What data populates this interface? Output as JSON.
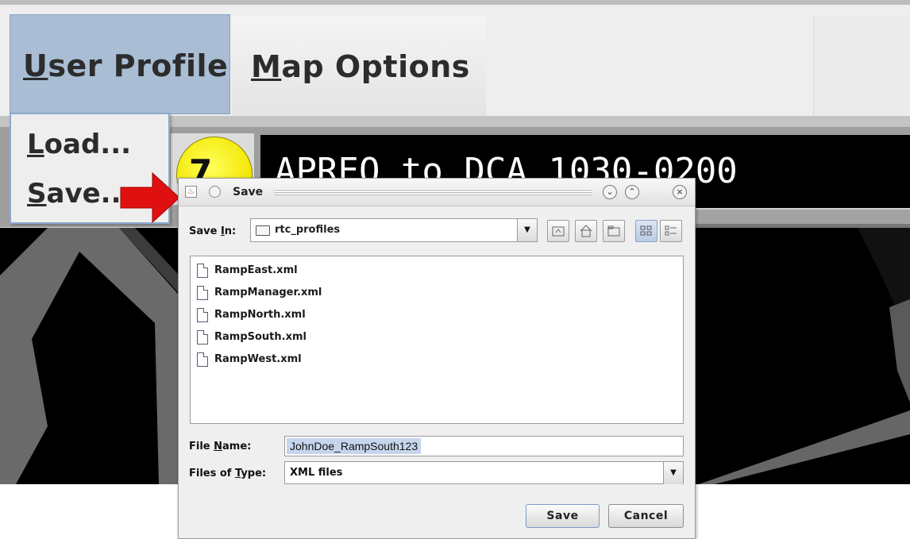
{
  "app": {
    "menus": [
      {
        "label_first": "U",
        "label_rest": "ser Profile"
      },
      {
        "label_first": "M",
        "label_rest": "ap Options"
      }
    ],
    "dropdown": {
      "load": {
        "first": "L",
        "rest": "oad..."
      },
      "save": {
        "first": "S",
        "rest": "ave..."
      }
    },
    "badge_number": "7",
    "title": "APREQ to DCA 1030-0200"
  },
  "dialog": {
    "title": "Save",
    "save_in_label": {
      "pre": "Save ",
      "u": "I",
      "post": "n:"
    },
    "current_folder": "rtc_profiles",
    "toolbar_icons": [
      "up-folder-icon",
      "home-icon",
      "new-folder-icon",
      "list-view-icon",
      "details-view-icon"
    ],
    "files": [
      "RampEast.xml",
      "RampManager.xml",
      "RampNorth.xml",
      "RampSouth.xml",
      "RampWest.xml"
    ],
    "file_name_label": {
      "pre": "File ",
      "u": "N",
      "post": "ame:"
    },
    "file_name_value": "JohnDoe_RampSouth123",
    "files_of_type_label": {
      "pre": "Files of ",
      "u": "T",
      "post": "ype:"
    },
    "files_of_type_value": "XML files",
    "save_button": "Save",
    "cancel_button": "Cancel"
  },
  "colors": {
    "menu_selected": "#a9bdd4",
    "badge_yellow": "#f2e600",
    "arrow_red": "#e01010",
    "title_bg": "#000000"
  }
}
